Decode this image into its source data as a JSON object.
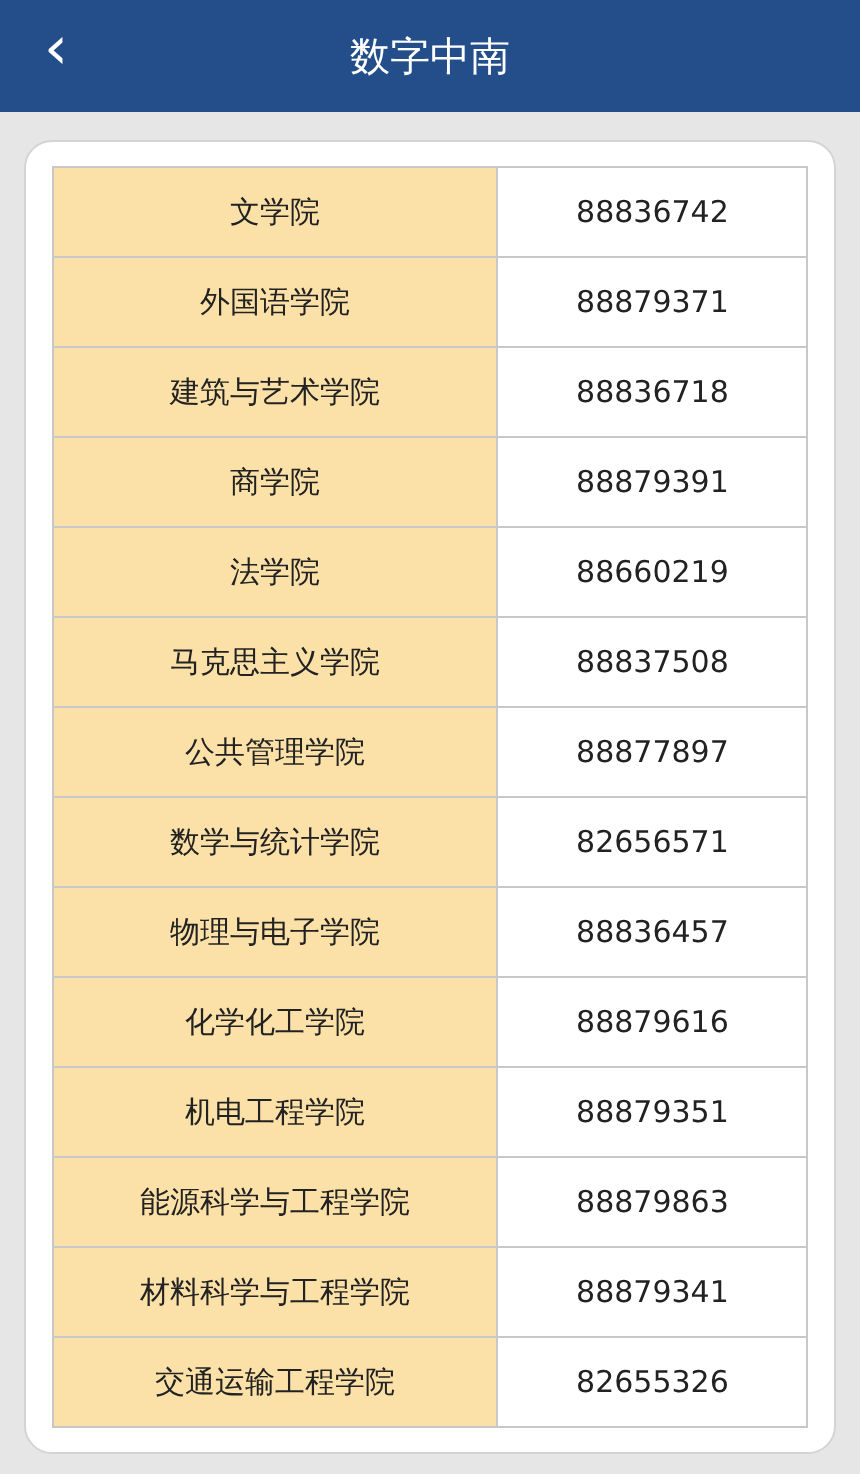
{
  "header": {
    "title": "数字中南",
    "back_icon": "‹"
  },
  "table": {
    "rows": [
      {
        "name": "文学院",
        "phone": "88836742"
      },
      {
        "name": "外国语学院",
        "phone": "88879371"
      },
      {
        "name": "建筑与艺术学院",
        "phone": "88836718"
      },
      {
        "name": "商学院",
        "phone": "88879391"
      },
      {
        "name": "法学院",
        "phone": "88660219"
      },
      {
        "name": "马克思主义学院",
        "phone": "88837508"
      },
      {
        "name": "公共管理学院",
        "phone": "88877897"
      },
      {
        "name": "数学与统计学院",
        "phone": "82656571"
      },
      {
        "name": "物理与电子学院",
        "phone": "88836457"
      },
      {
        "name": "化学化工学院",
        "phone": "88879616"
      },
      {
        "name": "机电工程学院",
        "phone": "88879351"
      },
      {
        "name": "能源科学与工程学院",
        "phone": "88879863"
      },
      {
        "name": "材料科学与工程学院",
        "phone": "88879341"
      },
      {
        "name": "交通运输工程学院",
        "phone": "82655326"
      }
    ]
  }
}
